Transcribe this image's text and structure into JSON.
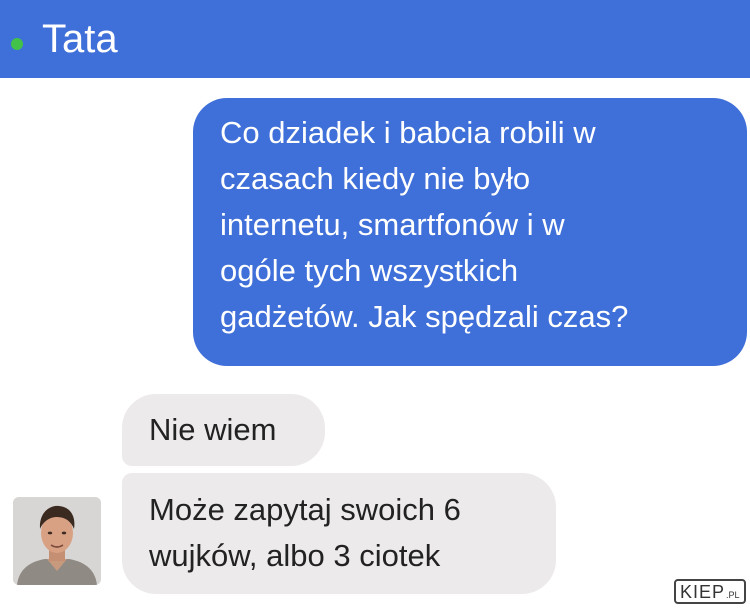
{
  "header": {
    "contact_name": "Tata",
    "online_status_color": "#43c24a",
    "background_color": "#3f6fd8"
  },
  "messages": [
    {
      "direction": "outgoing",
      "text": "Co dziadek i babcia robili w\nczasach kiedy nie było\ninternetu, smartfonów i w\nogóle tych wszystkich\ngadżetów. Jak spędzali czas?"
    },
    {
      "direction": "incoming",
      "text": "Nie wiem"
    },
    {
      "direction": "incoming",
      "text": "Może zapytaj swoich 6\nwujków, albo 3 ciotek"
    }
  ],
  "avatar": {
    "icon": "contact-avatar"
  },
  "watermark": {
    "main": "KIEP",
    "suffix": ".PL"
  }
}
